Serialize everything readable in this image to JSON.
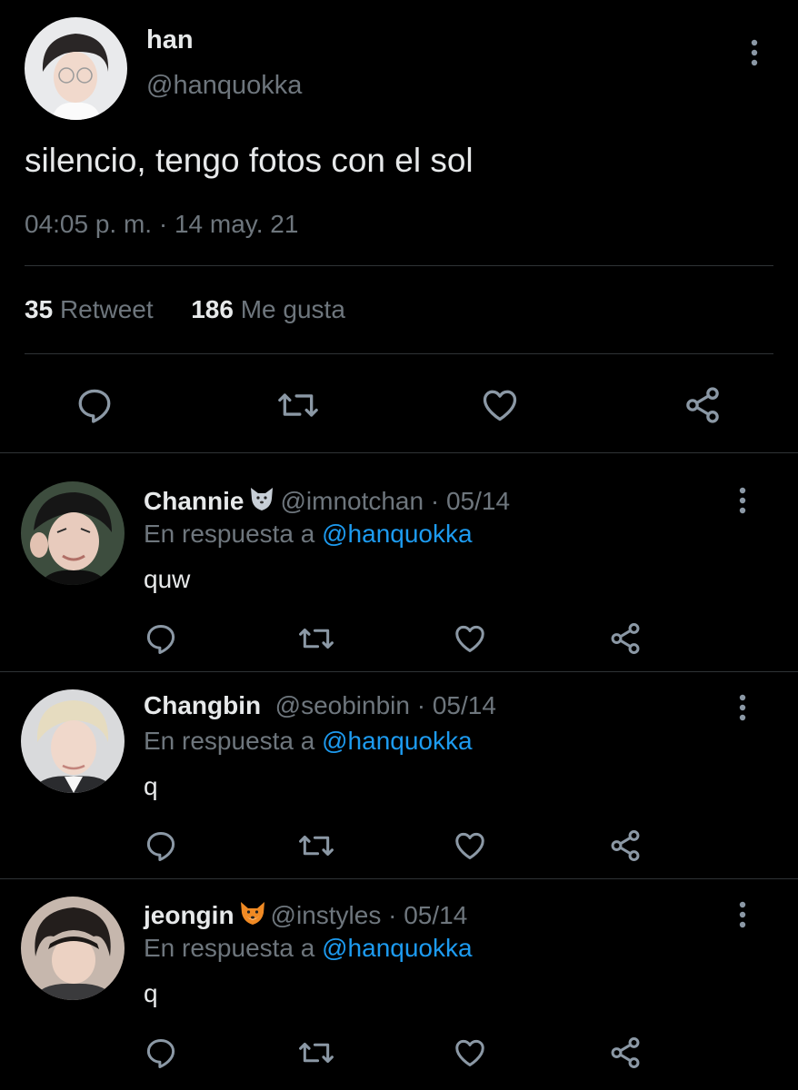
{
  "tweet": {
    "author_name": "han",
    "author_handle": "@hanquokka",
    "text": "silencio, tengo fotos con el sol",
    "timestamp": "04:05 p. m. · 14 may. 21",
    "retweet_count": "35",
    "retweet_label": "Retweet",
    "like_count": "186",
    "like_label": "Me gusta"
  },
  "replies": [
    {
      "name": "Channie",
      "emoji": "wolf-emoji",
      "handle_date": "@imnotchan · 05/14",
      "reply_prefix": "En respuesta a",
      "reply_to": "@hanquokka",
      "text": "quw"
    },
    {
      "name": "Changbin",
      "emoji": "",
      "handle_date": "@seobinbin · 05/14",
      "reply_prefix": "En respuesta a",
      "reply_to": "@hanquokka",
      "text": "q"
    },
    {
      "name": "jeongin",
      "emoji": "fox-emoji",
      "handle_date": "@instyles · 05/14",
      "reply_prefix": "En respuesta a",
      "reply_to": "@hanquokka",
      "text": "q"
    }
  ],
  "colors": {
    "background": "#000000",
    "text": "#e7e9ea",
    "muted": "#6e767d",
    "link": "#1d9bf0",
    "divider": "#2f3336"
  },
  "icons": [
    "more-vertical-icon",
    "reply-icon",
    "retweet-icon",
    "like-icon",
    "share-icon"
  ]
}
